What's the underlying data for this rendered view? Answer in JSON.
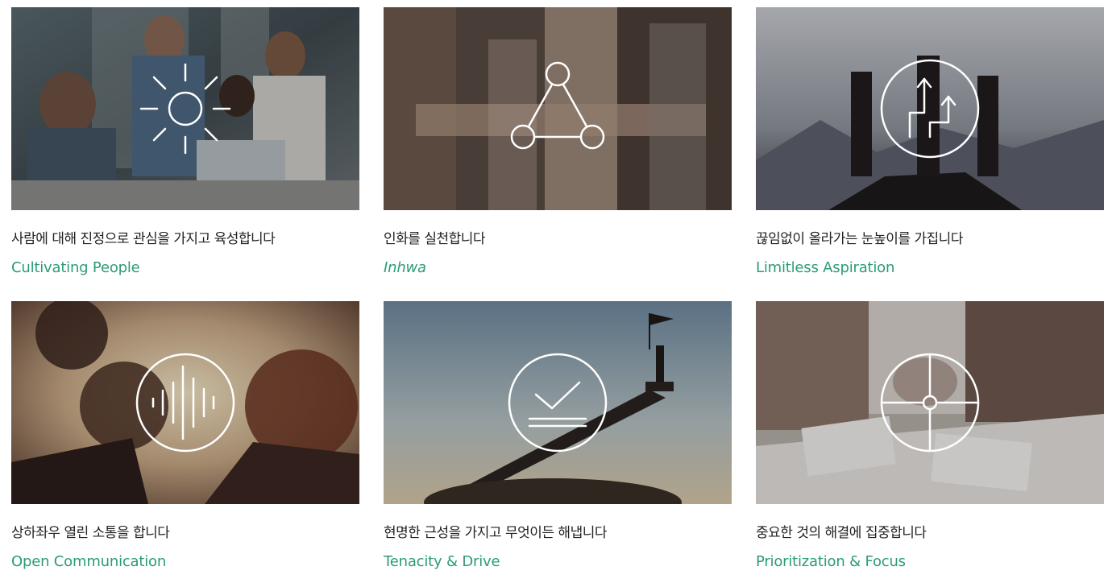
{
  "accent_color": "#2b9c78",
  "cards": [
    {
      "ko": "사람에 대해 진정으로 관심을 가지고 육성합니다",
      "en": "Cultivating People",
      "icon": "sun-lightbulb-icon"
    },
    {
      "ko": "인화를 실천합니다",
      "en": "Inhwa",
      "icon": "triangle-network-icon"
    },
    {
      "ko": "끊임없이 올라가는 눈높이를 가집니다",
      "en": "Limitless Aspiration",
      "icon": "rising-arrows-icon"
    },
    {
      "ko": "상하좌우 열린 소통을 합니다",
      "en": "Open Communication",
      "icon": "sound-wave-icon"
    },
    {
      "ko": "현명한 근성을 가지고 무엇이든 해냅니다",
      "en": "Tenacity & Drive",
      "icon": "checkmark-icon"
    },
    {
      "ko": "중요한 것의 해결에 집중합니다",
      "en": "Prioritization & Focus",
      "icon": "crosshair-icon"
    }
  ]
}
